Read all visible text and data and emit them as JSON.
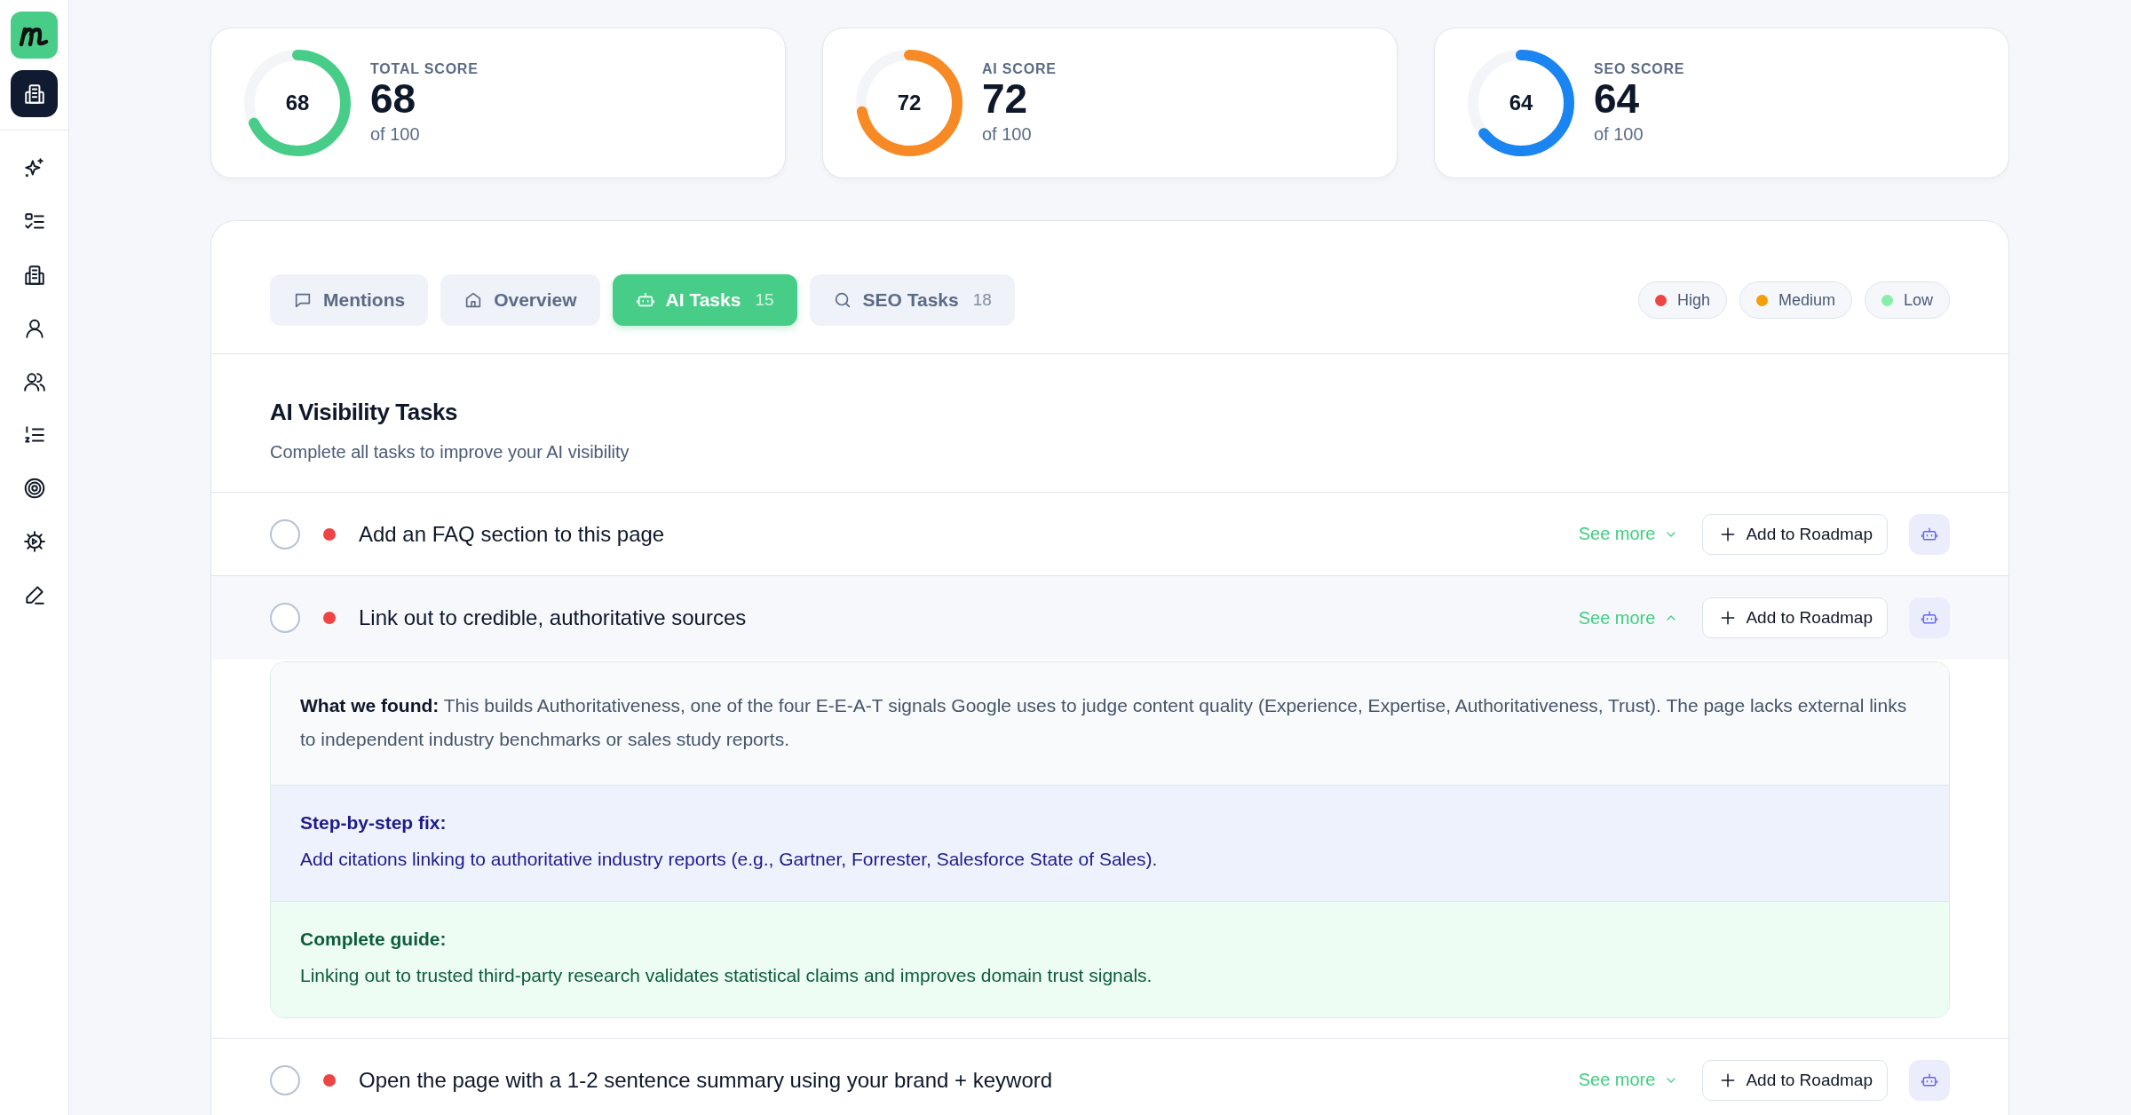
{
  "sidebar": {
    "items": [
      {
        "kind": "sparkle",
        "selected": false
      },
      {
        "kind": "checklist",
        "selected": false
      },
      {
        "kind": "building",
        "selected": false
      },
      {
        "kind": "user",
        "selected": false
      },
      {
        "kind": "users",
        "selected": false
      },
      {
        "kind": "numbered",
        "selected": false
      },
      {
        "kind": "target",
        "selected": false
      },
      {
        "kind": "gear",
        "selected": false
      },
      {
        "kind": "pen",
        "selected": false
      }
    ]
  },
  "scores": [
    {
      "label": "TOTAL SCORE",
      "ring_value": "68",
      "value": "68",
      "sub": "of 100",
      "level": 0.68,
      "color": "#48cd89"
    },
    {
      "label": "AI SCORE",
      "ring_value": "72",
      "value": "72",
      "sub": "of 100",
      "level": 0.72,
      "color": "#f78a25"
    },
    {
      "label": "SEO SCORE",
      "ring_value": "64",
      "value": "64",
      "sub": "of 100",
      "level": 0.64,
      "color": "#1a84f0"
    }
  ],
  "tabs": [
    {
      "label": "Mentions",
      "kind": "chat",
      "selected": false
    },
    {
      "label": "Overview",
      "kind": "home",
      "selected": false
    },
    {
      "label": "AI Tasks",
      "count": "15",
      "kind": "robot",
      "selected": true
    },
    {
      "label": "SEO Tasks",
      "count": "18",
      "kind": "search",
      "selected": false
    }
  ],
  "legend": [
    {
      "label": "High",
      "color": "#ef4444"
    },
    {
      "label": "Medium",
      "color": "#f59e0b"
    },
    {
      "label": "Low",
      "color": "#86efac"
    }
  ],
  "section": {
    "title": "AI Visibility Tasks",
    "subtitle": "Complete all tasks to improve your AI visibility"
  },
  "tasks": [
    {
      "title": "Add an FAQ section to this page",
      "color": "#ef4444",
      "checked": false,
      "expanded": false,
      "see_more": "See more",
      "add_button": "Add to Roadmap"
    },
    {
      "title": "Link out to credible, authoritative sources",
      "color": "#ef4444",
      "checked": false,
      "expanded": true,
      "see_more": "See more",
      "add_button": "Add to Roadmap",
      "details": {
        "found": "**What we found:** This builds Authoritativeness, one of the four E-E-A-T signals Google uses to judge content quality (Experience, Expertise, Authoritativeness, Trust). The page lacks external links to independent industry benchmarks or sales study reports.",
        "fix_title": "Step-by-step fix:",
        "fix_text": "Add citations linking to authoritative industry reports (e.g., Gartner, Forrester, Salesforce State of Sales).",
        "guide_title": "Complete guide:",
        "guide_text": "Linking out to trusted third-party research validates statistical claims and improves domain trust signals."
      }
    },
    {
      "title": "Open the page with a 1-2 sentence summary using your brand + keyword",
      "color": "#ef4444",
      "checked": false,
      "expanded": false,
      "see_more": "See more",
      "add_button": "Add to Roadmap"
    }
  ]
}
